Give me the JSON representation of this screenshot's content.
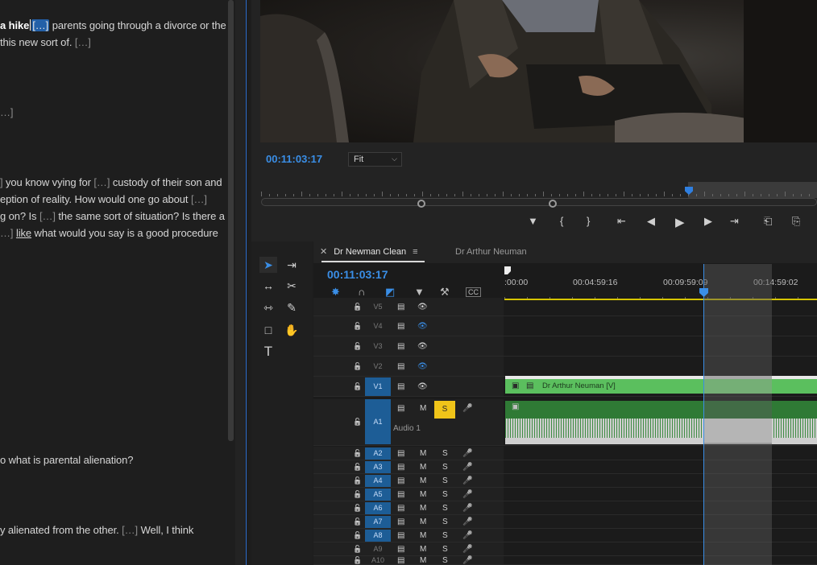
{
  "transcript": {
    "lines": [
      {
        "segments": [
          {
            "t": "a hike",
            "cls": "sel-word"
          },
          {
            "t": "",
            "cls": "caret"
          },
          {
            "t": "[…]",
            "cls": "gap-sel"
          },
          {
            "t": " parents going through a divorce or the",
            "cls": ""
          }
        ]
      },
      {
        "segments": [
          {
            "t": "this new sort of. ",
            "cls": ""
          },
          {
            "t": "[…]",
            "cls": "gap"
          }
        ]
      },
      {
        "segments": [
          {
            "t": "…]",
            "cls": "gap"
          }
        ]
      },
      {
        "segments": [
          {
            "t": "] ",
            "cls": "gap"
          },
          {
            "t": "you know vying for ",
            "cls": ""
          },
          {
            "t": "[…]",
            "cls": "gap"
          },
          {
            "t": " custody of their son and",
            "cls": ""
          }
        ]
      },
      {
        "segments": [
          {
            "t": "eption of reality. How would one go about ",
            "cls": ""
          },
          {
            "t": "[…]",
            "cls": "gap"
          }
        ]
      },
      {
        "segments": [
          {
            "t": "g on? Is ",
            "cls": ""
          },
          {
            "t": "[…]",
            "cls": "gap"
          },
          {
            "t": " the same sort of situation? Is there a",
            "cls": ""
          }
        ]
      },
      {
        "segments": [
          {
            "t": "…] ",
            "cls": "gap"
          },
          {
            "t": "like",
            "cls": "underline"
          },
          {
            "t": " what would you say is a good procedure",
            "cls": ""
          }
        ]
      },
      {
        "segments": [
          {
            "t": "o what is parental alienation?",
            "cls": ""
          }
        ]
      },
      {
        "segments": [
          {
            "t": "y alienated from the other. ",
            "cls": ""
          },
          {
            "t": "[…]",
            "cls": "gap"
          },
          {
            "t": " Well, I think",
            "cls": ""
          }
        ]
      }
    ]
  },
  "monitor": {
    "timecode": "00:11:03:17",
    "fit_value": "Fit",
    "transport_buttons": [
      "marker-icon",
      "mark-in-icon",
      "mark-out-icon",
      "go-to-in-icon",
      "step-back-icon",
      "play-icon",
      "step-forward-icon",
      "go-to-out-icon",
      "insert-icon",
      "overwrite-icon"
    ]
  },
  "timeline": {
    "tabs": [
      {
        "label": "Dr Newman Clean",
        "active": true
      },
      {
        "label": "Dr Arthur Neuman",
        "active": false
      }
    ],
    "timecode": "00:11:03:17",
    "ruler_labels": [
      ":00:00",
      "00:04:59:16",
      "00:09:59:09",
      "00:14:59:02"
    ],
    "tracks": [
      {
        "label": "V5",
        "on": false
      },
      {
        "label": "V4",
        "on": false
      },
      {
        "label": "V3",
        "on": false
      },
      {
        "label": "V2",
        "on": false
      },
      {
        "label": "V1",
        "on": true
      },
      {
        "label": "A1",
        "on": true,
        "name": "Audio 1",
        "m": "M",
        "s": "S"
      },
      {
        "label": "A2",
        "on": true,
        "m": "M",
        "s": "S"
      },
      {
        "label": "A3",
        "on": true,
        "m": "M",
        "s": "S"
      },
      {
        "label": "A4",
        "on": true,
        "m": "M",
        "s": "S"
      },
      {
        "label": "A5",
        "on": true,
        "m": "M",
        "s": "S"
      },
      {
        "label": "A6",
        "on": true,
        "m": "M",
        "s": "S"
      },
      {
        "label": "A7",
        "on": true,
        "m": "M",
        "s": "S"
      },
      {
        "label": "A8",
        "on": true,
        "m": "M",
        "s": "S"
      },
      {
        "label": "A9",
        "on": false,
        "m": "M",
        "s": "S"
      },
      {
        "label": "A10",
        "on": false,
        "m": "M",
        "s": "S"
      }
    ],
    "video_clip_name": "Dr Arthur Neuman [V]",
    "colors": {
      "accent": "#3a8ee6",
      "video_clip": "#5bbf5e",
      "audio_clip": "#2f7a35",
      "solo": "#f0c419",
      "playhead": "#3a8ee6"
    }
  }
}
